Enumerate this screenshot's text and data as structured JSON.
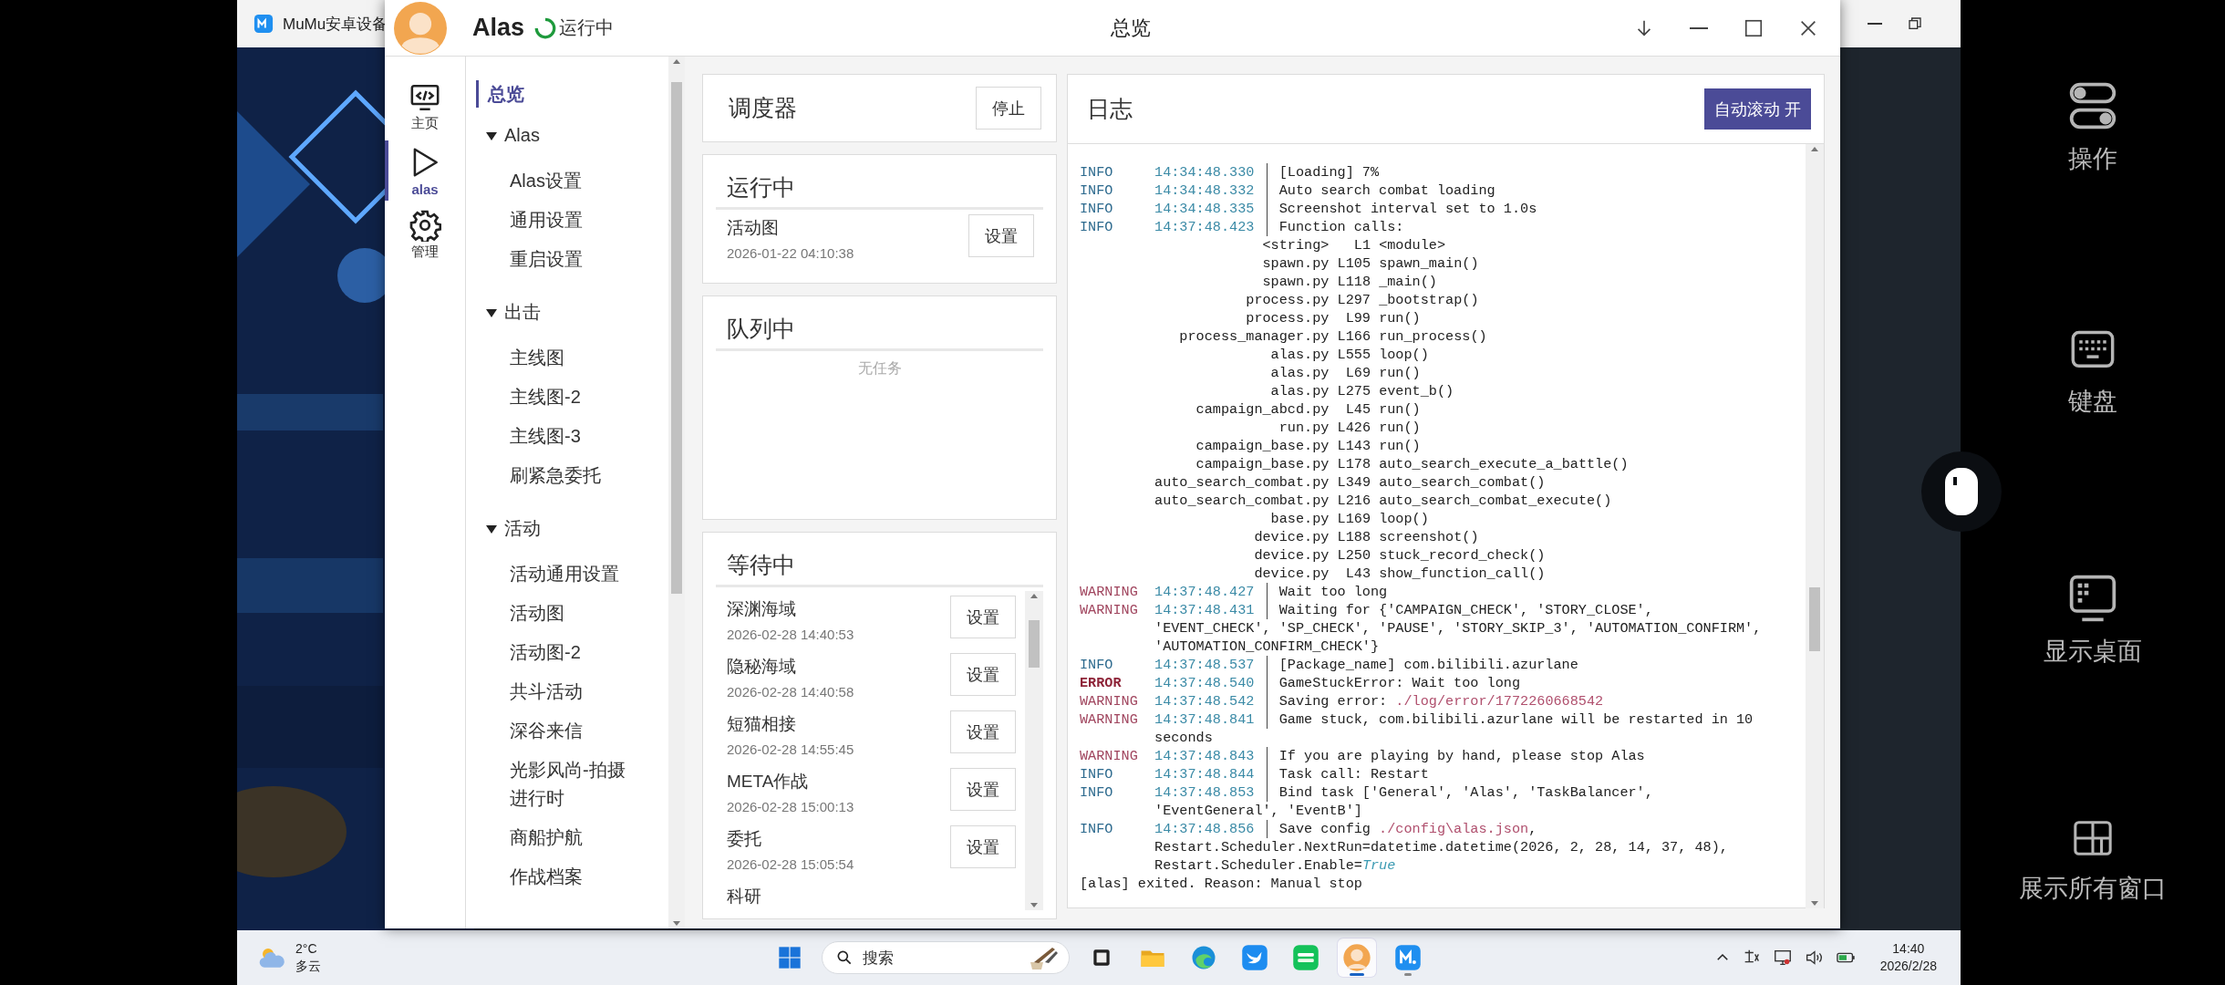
{
  "emulator": {
    "title": "MuMu安卓设备"
  },
  "alas": {
    "app_name": "Alas",
    "status": "运行中",
    "title": "总览"
  },
  "nav": [
    {
      "kind": "code",
      "label": "主页",
      "selected": false
    },
    {
      "kind": "play",
      "label": "alas",
      "selected": true
    },
    {
      "kind": "gear",
      "label": "管理",
      "selected": false
    }
  ],
  "menu": [
    {
      "label": "总览",
      "selected": true
    },
    {
      "label": "Alas",
      "expanded": true,
      "children": [
        {
          "label": "Alas设置",
          "selected": false
        },
        {
          "label": "通用设置",
          "selected": false
        },
        {
          "label": "重启设置",
          "selected": false
        }
      ]
    },
    {
      "label": "出击",
      "expanded": true,
      "children": [
        {
          "label": "主线图",
          "selected": false
        },
        {
          "label": "主线图-2",
          "selected": false
        },
        {
          "label": "主线图-3",
          "selected": false
        },
        {
          "label": "刷紧急委托",
          "selected": false
        }
      ]
    },
    {
      "label": "活动",
      "expanded": true,
      "children": [
        {
          "label": "活动通用设置",
          "selected": false
        },
        {
          "label": "活动图",
          "selected": false
        },
        {
          "label": "活动图-2",
          "selected": false
        },
        {
          "label": "共斗活动",
          "selected": false
        },
        {
          "label": "深谷来信",
          "selected": false
        },
        {
          "label": "光影风尚-拍摄进行时",
          "selected": false
        },
        {
          "label": "商船护航",
          "selected": false
        },
        {
          "label": "作战档案",
          "selected": false
        }
      ]
    }
  ],
  "scheduler": {
    "title": "调度器",
    "button": "停止"
  },
  "running": {
    "title": "运行中",
    "tasks": [
      {
        "name": "活动图",
        "time": "2026-01-22 04:10:38",
        "button": "设置"
      }
    ]
  },
  "queue": {
    "title": "队列中",
    "empty_text": "无任务"
  },
  "waiting": {
    "title": "等待中",
    "tasks": [
      {
        "name": "深渊海域",
        "time": "2026-02-28 14:40:53",
        "button": "设置"
      },
      {
        "name": "隐秘海域",
        "time": "2026-02-28 14:40:58",
        "button": "设置"
      },
      {
        "name": "短猫相接",
        "time": "2026-02-28 14:55:45",
        "button": "设置"
      },
      {
        "name": "META作战",
        "time": "2026-02-28 15:00:13",
        "button": "设置"
      },
      {
        "name": "委托",
        "time": "2026-02-28 15:05:54",
        "button": "设置"
      },
      {
        "name": "科研"
      }
    ]
  },
  "log": {
    "title": "日志",
    "button": "自动滚动 开",
    "lines": [
      {
        "kind": "entry",
        "level": "INFO",
        "time": "14:34:48.330",
        "message": "[Loading] 7%"
      },
      {
        "kind": "entry",
        "level": "INFO",
        "time": "14:34:48.332",
        "message": "Auto search combat loading"
      },
      {
        "kind": "entry",
        "level": "INFO",
        "time": "14:34:48.335",
        "message": "Screenshot interval set to 1.0s"
      },
      {
        "kind": "entry",
        "level": "INFO",
        "time": "14:37:48.423",
        "message": "Function calls:"
      },
      {
        "kind": "trace",
        "file": "<string>",
        "line": "L1",
        "call": "<module>"
      },
      {
        "kind": "trace",
        "file": "spawn.py",
        "line": "L105",
        "call": "spawn_main()"
      },
      {
        "kind": "trace",
        "file": "spawn.py",
        "line": "L118",
        "call": "_main()"
      },
      {
        "kind": "trace",
        "file": "process.py",
        "line": "L297",
        "call": "_bootstrap()"
      },
      {
        "kind": "trace",
        "file": "process.py",
        "line": "L99",
        "call": "run()"
      },
      {
        "kind": "trace",
        "file": "process_manager.py",
        "line": "L166",
        "call": "run_process()"
      },
      {
        "kind": "trace",
        "file": "alas.py",
        "line": "L555",
        "call": "loop()"
      },
      {
        "kind": "trace",
        "file": "alas.py",
        "line": "L69",
        "call": "run()"
      },
      {
        "kind": "trace",
        "file": "alas.py",
        "line": "L275",
        "call": "event_b()"
      },
      {
        "kind": "trace",
        "file": "campaign_abcd.py",
        "line": "L45",
        "call": "run()"
      },
      {
        "kind": "trace",
        "file": "run.py",
        "line": "L426",
        "call": "run()"
      },
      {
        "kind": "trace",
        "file": "campaign_base.py",
        "line": "L143",
        "call": "run()"
      },
      {
        "kind": "trace",
        "file": "campaign_base.py",
        "line": "L178",
        "call": "auto_search_execute_a_battle()"
      },
      {
        "kind": "trace",
        "file": "auto_search_combat.py",
        "line": "L349",
        "call": "auto_search_combat()"
      },
      {
        "kind": "trace",
        "file": "auto_search_combat.py",
        "line": "L216",
        "call": "auto_search_combat_execute()"
      },
      {
        "kind": "trace",
        "file": "base.py",
        "line": "L169",
        "call": "loop()"
      },
      {
        "kind": "trace",
        "file": "device.py",
        "line": "L188",
        "call": "screenshot()"
      },
      {
        "kind": "trace",
        "file": "device.py",
        "line": "L250",
        "call": "stuck_record_check()"
      },
      {
        "kind": "trace",
        "file": "device.py",
        "line": "L43",
        "call": "show_function_call()"
      },
      {
        "kind": "entry",
        "level": "WARNING",
        "time": "14:37:48.427",
        "message": "Wait too long"
      },
      {
        "kind": "entry",
        "level": "WARNING",
        "time": "14:37:48.431",
        "message": "Waiting for {'CAMPAIGN_CHECK', 'STORY_CLOSE', 'EVENT_CHECK', 'SP_CHECK', 'PAUSE', 'STORY_SKIP_3', 'AUTOMATION_CONFIRM', 'AUTOMATION_CONFIRM_CHECK'}"
      },
      {
        "kind": "entry",
        "level": "INFO",
        "time": "14:37:48.537",
        "message": "[Package_name] com.bilibili.azurlane"
      },
      {
        "kind": "entry",
        "level": "ERROR",
        "time": "14:37:48.540",
        "message": "GameStuckError: Wait too long"
      },
      {
        "kind": "entry",
        "level": "WARNING",
        "time": "14:37:48.542",
        "parts": [
          {
            "kind": "text",
            "text": "Saving error: "
          },
          {
            "kind": "path",
            "text": "./log/error/1772260668542"
          }
        ]
      },
      {
        "kind": "entry",
        "level": "WARNING",
        "time": "14:37:48.841",
        "message": "Game stuck, com.bilibili.azurlane will be restarted in 10 seconds"
      },
      {
        "kind": "entry",
        "level": "WARNING",
        "time": "14:37:48.843",
        "message": "If you are playing by hand, please stop Alas"
      },
      {
        "kind": "entry",
        "level": "INFO",
        "time": "14:37:48.844",
        "message": "Task call: Restart"
      },
      {
        "kind": "entry",
        "level": "INFO",
        "time": "14:37:48.853",
        "message": "Bind task ['General', 'Alas', 'TaskBalancer', 'EventGeneral', 'EventB']"
      },
      {
        "kind": "entry",
        "level": "INFO",
        "time": "14:37:48.856",
        "parts": [
          {
            "kind": "text",
            "text": "Save config "
          },
          {
            "kind": "path",
            "text": "./config\\alas.json"
          },
          {
            "kind": "text",
            "text": ", Restart.Scheduler.NextRun=datetime.datetime(2026, 2, 28, 14, 37, 48), Restart.Scheduler.Enable="
          },
          {
            "kind": "bool",
            "text": "True"
          }
        ]
      },
      {
        "kind": "plain",
        "text": "[alas] exited. Reason: Manual stop"
      }
    ]
  },
  "taskbar": {
    "weather": {
      "temp": "2°C",
      "condition": "多云"
    },
    "search": {
      "placeholder": "搜索"
    },
    "apps": [
      {
        "kind": "taskview",
        "selected": false,
        "running": false
      },
      {
        "kind": "folder",
        "selected": false,
        "running": false
      },
      {
        "kind": "browser",
        "selected": false,
        "running": false
      },
      {
        "kind": "bird",
        "selected": false,
        "running": false
      },
      {
        "kind": "video",
        "selected": false,
        "running": false
      },
      {
        "kind": "avatar",
        "selected": true,
        "running": true
      },
      {
        "kind": "emulator",
        "selected": false,
        "running": true
      }
    ],
    "clock": {
      "time": "14:40",
      "date": "2026/2/28"
    }
  },
  "side_panel": [
    {
      "kind": "toggles",
      "label": "操作"
    },
    {
      "kind": "keyboard",
      "label": "键盘"
    },
    {
      "kind": "desktop",
      "label": "显示桌面"
    },
    {
      "kind": "windows",
      "label": "展示所有窗口"
    }
  ]
}
